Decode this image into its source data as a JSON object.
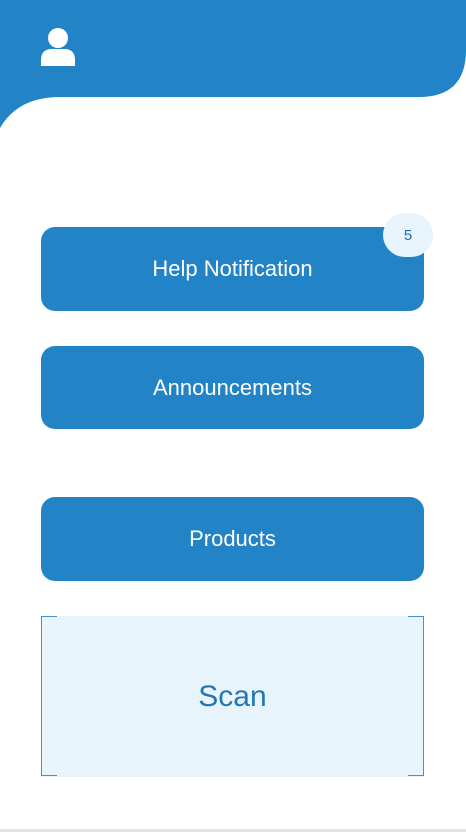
{
  "header": {
    "avatar_icon": "user-icon",
    "color": "#2283c6"
  },
  "menu": {
    "help_notification": {
      "label": "Help Notification",
      "badge_count": "5"
    },
    "announcements": {
      "label": "Announcements"
    },
    "products": {
      "label": "Products"
    }
  },
  "scan": {
    "label": "Scan"
  },
  "colors": {
    "primary": "#2283c6",
    "scan_bg": "#e8f4fc",
    "scan_text": "#2477b3"
  }
}
